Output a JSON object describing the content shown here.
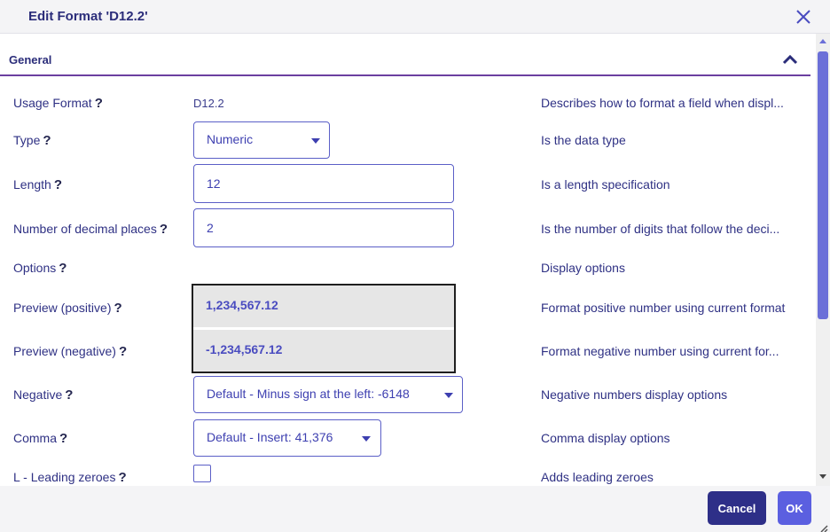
{
  "dialog": {
    "title": "Edit Format 'D12.2'",
    "close_icon": "close-icon"
  },
  "section": {
    "title": "General",
    "collapse_icon": "chevron-up-icon"
  },
  "help_glyph": "?",
  "rows": {
    "usage_format": {
      "label": "Usage Format",
      "value": "D12.2",
      "desc": "Describes how to format a field when displ..."
    },
    "type": {
      "label": "Type",
      "value": "Numeric",
      "desc": "Is the data type"
    },
    "length": {
      "label": "Length",
      "value": "12",
      "desc": "Is a length specification"
    },
    "decimals": {
      "label": "Number of decimal places",
      "value": "2",
      "desc": "Is the number of digits that follow the deci..."
    },
    "options": {
      "label": "Options",
      "desc": "Display options"
    },
    "preview_positive": {
      "label": "Preview (positive)",
      "value": "1,234,567.12",
      "desc": "Format positive number using current format"
    },
    "preview_negative": {
      "label": "Preview (negative)",
      "value": "-1,234,567.12",
      "desc": "Format negative number using current for..."
    },
    "negative": {
      "label": "Negative",
      "value": "Default - Minus sign at the left: -6148",
      "desc": "Negative numbers display options"
    },
    "comma": {
      "label": "Comma",
      "value": "Default - Insert: 41,376",
      "desc": "Comma display options"
    },
    "leading_zeroes": {
      "label": "L - Leading zeroes",
      "checked": false,
      "desc": "Adds leading zeroes"
    }
  },
  "footer": {
    "cancel_label": "Cancel",
    "ok_label": "OK"
  },
  "colors": {
    "accent": "#5b5fe0",
    "primary_dark": "#2e2f88",
    "section_rule": "#6b3fa0",
    "scroll_thumb": "#6b6fd8"
  }
}
